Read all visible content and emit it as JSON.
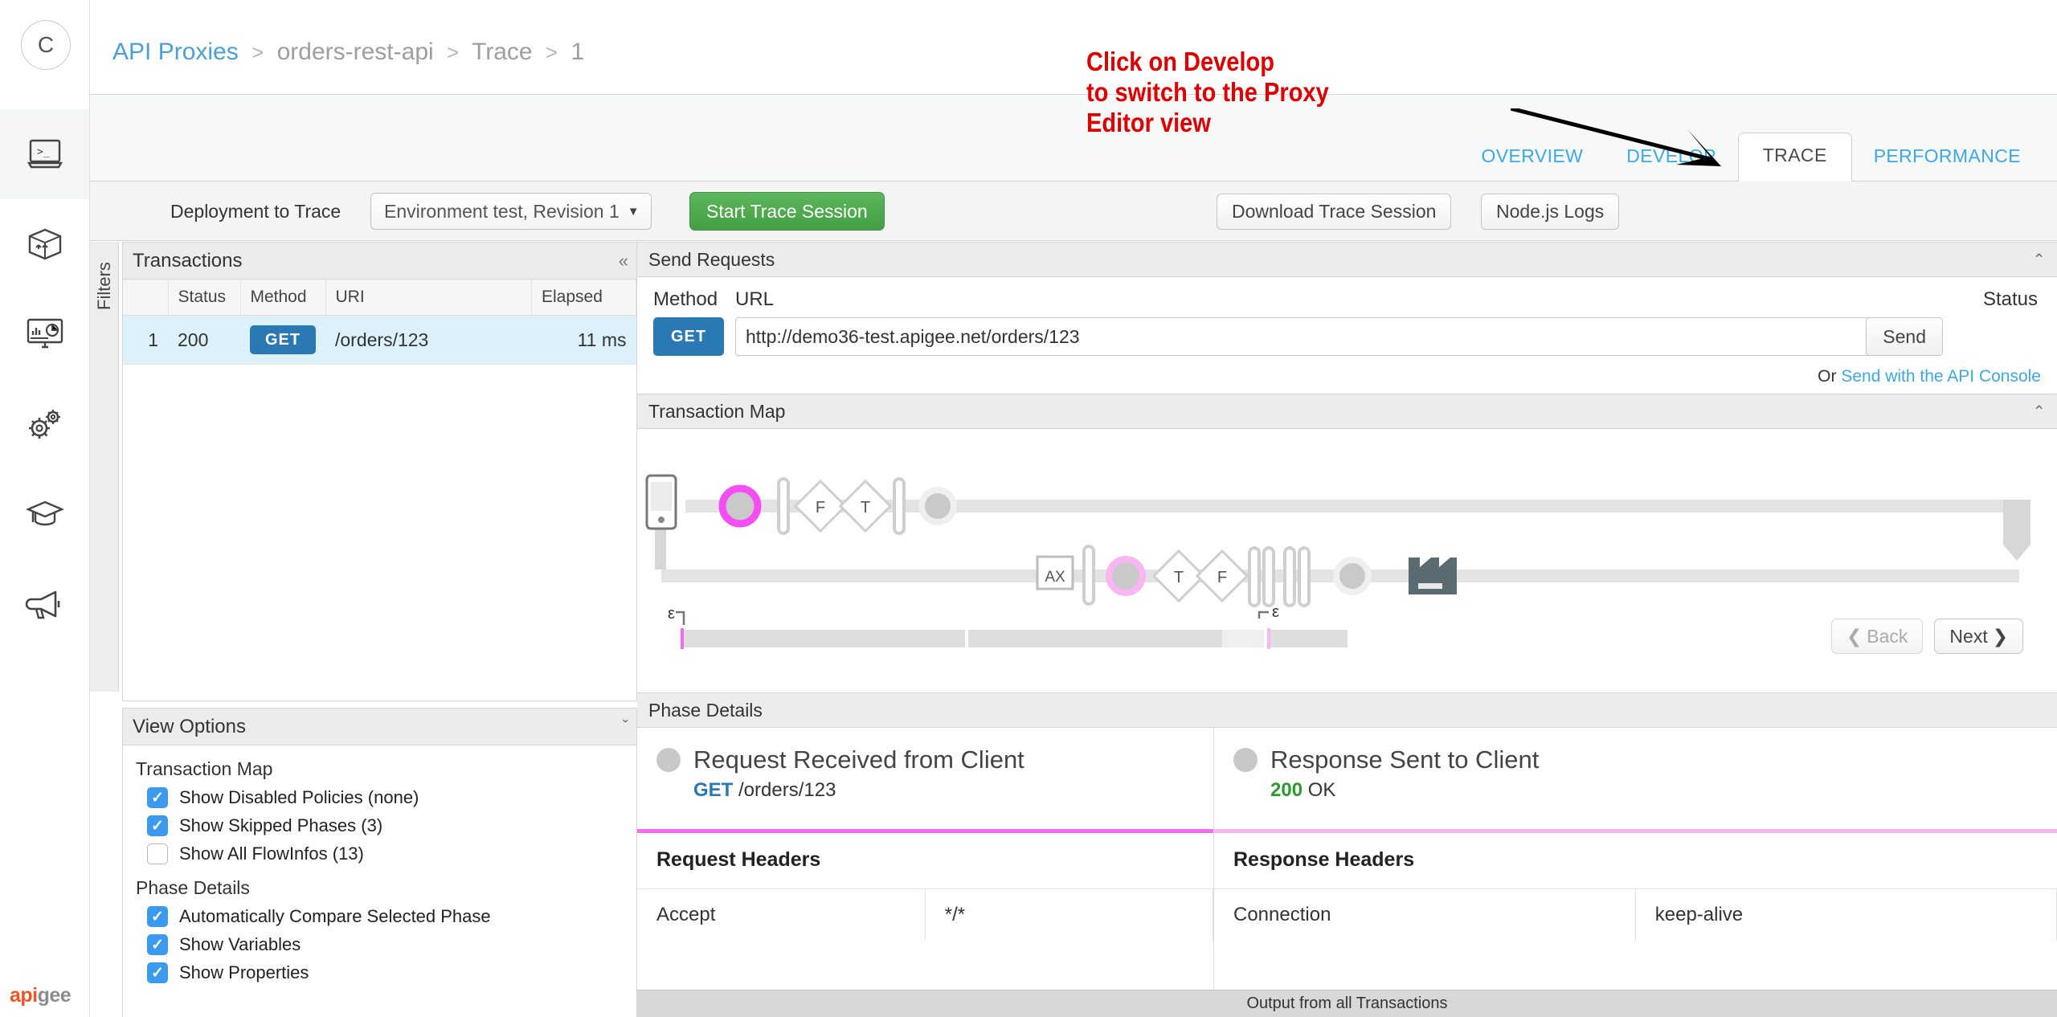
{
  "rail": {
    "avatar_initial": "C",
    "items": [
      {
        "name": "develop-icon",
        "label": "Develop"
      },
      {
        "name": "publish-icon",
        "label": "Publish"
      },
      {
        "name": "analyze-icon",
        "label": "Analyze"
      },
      {
        "name": "admin-icon",
        "label": "Admin"
      },
      {
        "name": "learn-icon",
        "label": "Learn"
      },
      {
        "name": "announcements-icon",
        "label": "Announcements"
      }
    ],
    "logo_part1": "api",
    "logo_part2": "gee"
  },
  "breadcrumb": {
    "root": "API Proxies",
    "sep": ">",
    "proxy": "orders-rest-api",
    "section": "Trace",
    "revision": "1"
  },
  "tabs": [
    {
      "label": "OVERVIEW",
      "active": false
    },
    {
      "label": "DEVELOP",
      "active": false
    },
    {
      "label": "TRACE",
      "active": true
    },
    {
      "label": "PERFORMANCE",
      "active": false
    }
  ],
  "annotation": {
    "line1": "Click on Develop",
    "line2": "to switch to the Proxy",
    "line3": "Editor view",
    "color": "#e00000"
  },
  "toolbar": {
    "deployment_label": "Deployment to Trace",
    "deployment_value": "Environment test, Revision 1",
    "start_trace_label": "Start Trace Session",
    "download_label": "Download Trace Session",
    "nodejs_label": "Node.js Logs"
  },
  "filters_strip_label": "Filters",
  "transactions": {
    "title": "Transactions",
    "collapse_glyph": "«",
    "columns": [
      "",
      "Status",
      "Method",
      "URI",
      "Elapsed"
    ],
    "rows": [
      {
        "num": "1",
        "status": "200",
        "method": "GET",
        "uri": "/orders/123",
        "elapsed": "11 ms"
      }
    ]
  },
  "view_options": {
    "title": "View Options",
    "expand_glyph": "ˇ",
    "groups": [
      {
        "title": "Transaction Map",
        "items": [
          {
            "label": "Show Disabled Policies (none)",
            "checked": true
          },
          {
            "label": "Show Skipped Phases (3)",
            "checked": true
          },
          {
            "label": "Show All FlowInfos (13)",
            "checked": false
          }
        ]
      },
      {
        "title": "Phase Details",
        "items": [
          {
            "label": "Automatically Compare Selected Phase",
            "checked": true
          },
          {
            "label": "Show Variables",
            "checked": true
          },
          {
            "label": "Show Properties",
            "checked": true
          }
        ]
      }
    ]
  },
  "send_requests": {
    "title": "Send Requests",
    "collapse_glyph": "«",
    "method_label": "Method",
    "url_label": "URL",
    "status_label": "Status",
    "method_value": "GET",
    "url_value": "http://demo36-test.apigee.net/orders/123",
    "url_placeholder": "http://",
    "send_label": "Send",
    "or_text": "Or ",
    "api_console_link": "Send with the API Console"
  },
  "transaction_map": {
    "title": "Transaction Map",
    "collapse_glyph": "«",
    "row1_nodes": [
      "client-phone",
      "request-received",
      "bar",
      "F",
      "T",
      "bar",
      "endpoint"
    ],
    "row2_nodes": [
      "AX",
      "bar",
      "response-sent",
      "T",
      "F",
      "bar",
      "bar",
      "bar",
      "bar",
      "endpoint",
      "target-server"
    ],
    "timeline_left_label": "ε",
    "timeline_right_label": "ε",
    "back_label": "Back",
    "next_label": "Next",
    "back_glyph": "❮",
    "next_glyph": "❯"
  },
  "phase_details": {
    "title": "Phase Details",
    "left": {
      "title": "Request Received from Client",
      "method": "GET",
      "path": "/orders/123",
      "headers_title": "Request Headers",
      "rows": [
        [
          "Accept",
          "*/*"
        ]
      ]
    },
    "right": {
      "title": "Response Sent to Client",
      "status_code": "200",
      "status_text": "OK",
      "headers_title": "Response Headers",
      "rows": [
        [
          "Connection",
          "keep-alive"
        ]
      ]
    }
  },
  "footer": {
    "output_label": "Output from all Transactions"
  }
}
